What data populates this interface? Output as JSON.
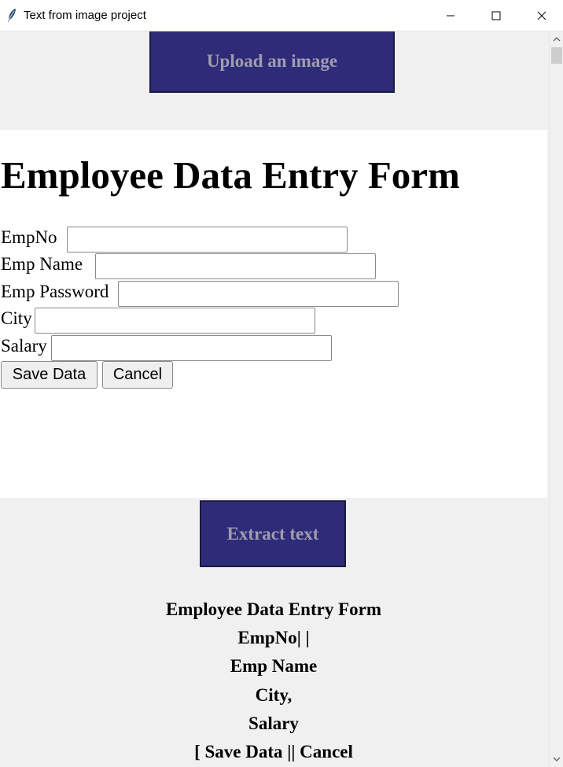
{
  "window": {
    "title": "Text from image project"
  },
  "upload_button": {
    "label": "Upload an image"
  },
  "image_form": {
    "heading": "Employee Data Entry Form",
    "fields": [
      {
        "label": "EmpNo",
        "value": ""
      },
      {
        "label": "Emp Name",
        "value": ""
      },
      {
        "label": "Emp Password",
        "value": ""
      },
      {
        "label": "City",
        "value": ""
      },
      {
        "label": "Salary",
        "value": ""
      }
    ],
    "save_label": "Save Data",
    "cancel_label": "Cancel"
  },
  "extract_button": {
    "label": "Extract text"
  },
  "extracted_text": {
    "lines": [
      "Employee Data Entry Form",
      "EmpNo| |",
      "Emp Name",
      "City,",
      "Salary",
      "[ Save Data || Cancel"
    ]
  },
  "colors": {
    "button_bg": "#2e2c78",
    "button_text": "#a09cb0",
    "window_bg": "#f0f0f0"
  }
}
